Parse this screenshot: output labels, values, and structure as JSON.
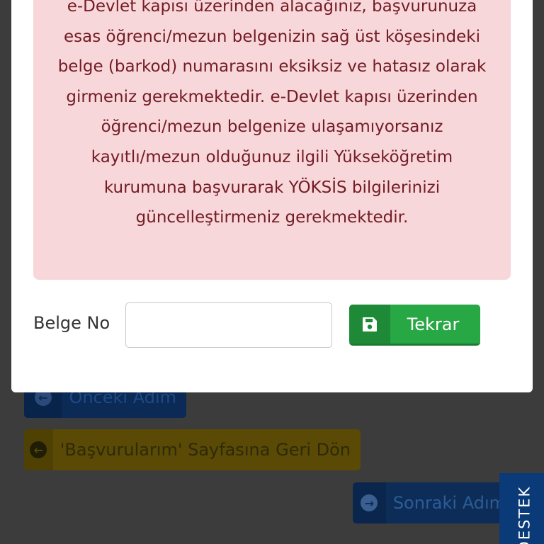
{
  "background": {
    "prev_button": {
      "label": "Önceki Adım",
      "icon": "arrow-circle-left-icon"
    },
    "back_to_applications_button": {
      "label": "'Başvurularım' Sayfasına Geri Dön",
      "icon": "arrow-circle-left-icon"
    },
    "next_button": {
      "label": "Sonraki Adım",
      "icon": "arrow-circle-right-icon"
    },
    "support_tab": {
      "label": "DESTEK"
    }
  },
  "modal": {
    "alert": {
      "text": "e-Devlet kapısı üzerinden alacağınız, başvurunuza esas öğrenci/mezun belgenizin sağ üst köşesindeki belge (barkod) numarasını eksiksiz ve hatasız olarak girmeniz gerekmektedir. e-Devlet kapısı üzerinden öğrenci/mezun belgenize ulaşamıyorsanız kayıtlı/mezun olduğunuz ilgili Yükseköğretim kurumuna başvurarak YÖKSİS bilgilerinizi güncelleştirmeniz gerekmektedir."
    },
    "form": {
      "belge_label": "Belge No",
      "belge_value": "",
      "submit_label": "Tekrar",
      "submit_icon": "save-icon"
    }
  },
  "colors": {
    "alert_bg": "#f8d7da",
    "alert_text": "#721c24",
    "success": "#28a745",
    "support_tab": "#0b3a78"
  }
}
